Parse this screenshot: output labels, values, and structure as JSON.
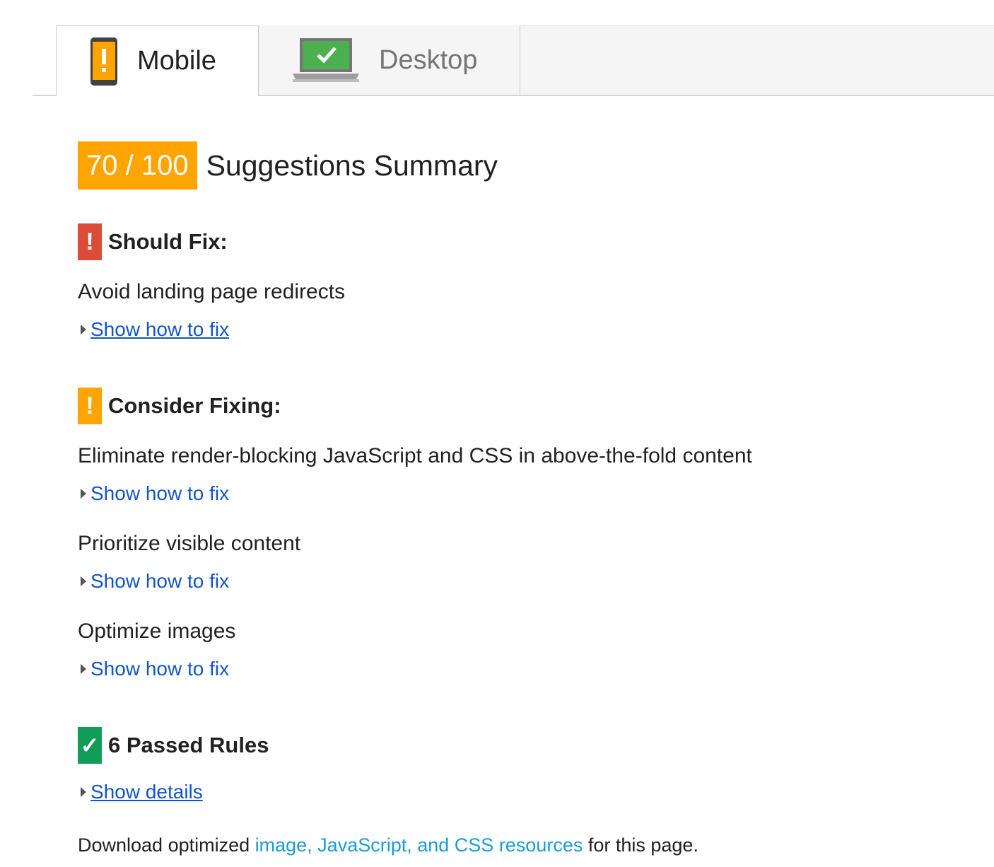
{
  "tabs": {
    "mobile_label": "Mobile",
    "desktop_label": "Desktop",
    "active": "mobile"
  },
  "summary": {
    "score": "70 / 100",
    "title": "Suggestions Summary",
    "score_color": "#ffa400"
  },
  "should_fix": {
    "title": "Should Fix:",
    "flag_icon": "exclamation-icon",
    "flag_color": "#dd4b39",
    "rules": [
      {
        "name": "Avoid landing page redirects",
        "link": "Show how to fix"
      }
    ]
  },
  "consider_fixing": {
    "title": "Consider Fixing:",
    "flag_icon": "exclamation-icon",
    "flag_color": "#ffa400",
    "rules": [
      {
        "name": "Eliminate render-blocking JavaScript and CSS in above-the-fold content",
        "link": "Show how to fix"
      },
      {
        "name": "Prioritize visible content",
        "link": "Show how to fix"
      },
      {
        "name": "Optimize images",
        "link": "Show how to fix"
      }
    ]
  },
  "passed": {
    "title": "6 Passed Rules",
    "flag_icon": "checkmark-icon",
    "flag_color": "#0f9d58",
    "link": "Show details"
  },
  "download": {
    "prefix": "Download optimized ",
    "link": "image, JavaScript, and CSS resources",
    "suffix": " for this page."
  }
}
